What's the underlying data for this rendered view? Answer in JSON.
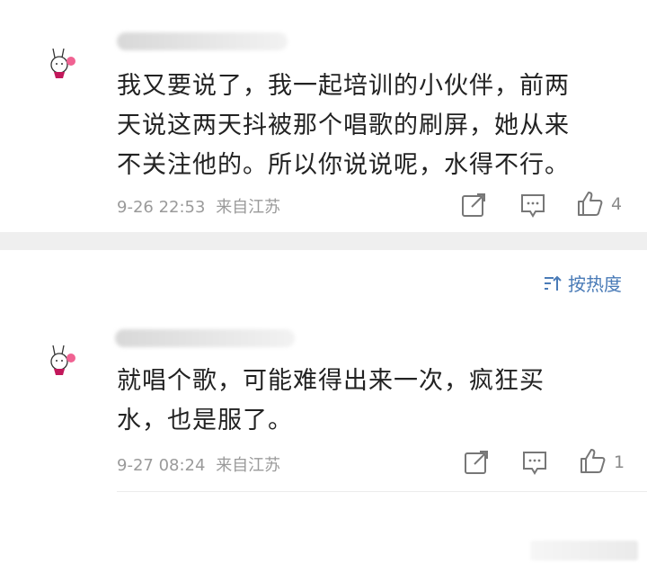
{
  "comments": [
    {
      "text_line1": "我又要说了，我一起培训的小伙伴，前两",
      "text_line2": "天说这两天抖被那个唱歌的刷屏，她从来",
      "text_line3": "不关注他的。所以你说说呢，水得不行。",
      "time": "9-26 22:53",
      "location": "来自江苏",
      "likes": "4"
    },
    {
      "text_line1": "就唱个歌，可能难得出来一次，疯狂买",
      "text_line2": "水，也是服了。",
      "time": "9-27 08:24",
      "location": "来自江苏",
      "likes": "1"
    }
  ],
  "sort": {
    "label": "按热度"
  },
  "icons": [
    "share-icon",
    "reply-icon",
    "thumbs-up-icon",
    "sort-icon"
  ]
}
